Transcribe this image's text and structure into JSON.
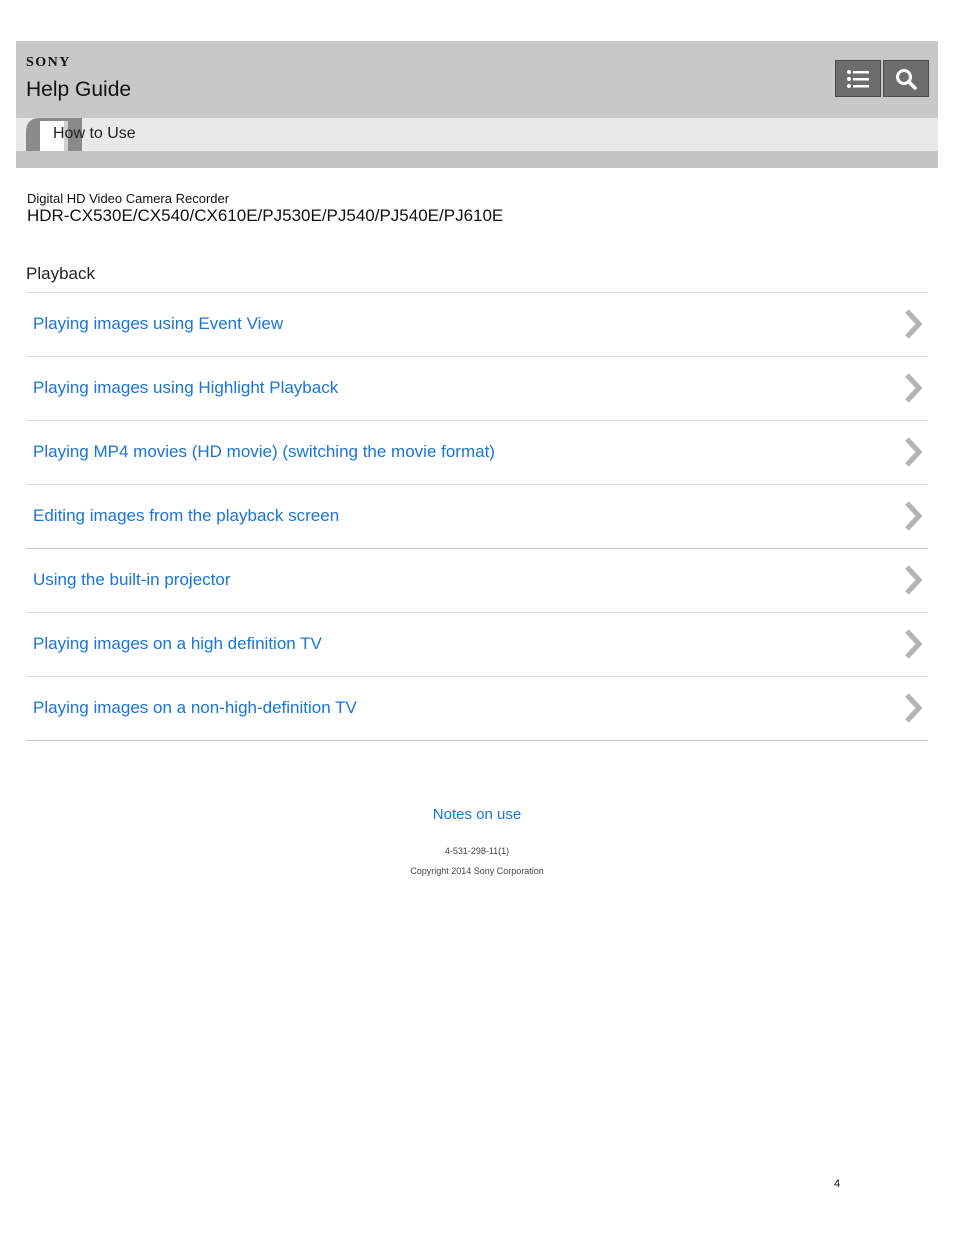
{
  "header": {
    "brand": "SONY",
    "title": "Help Guide",
    "toolbar": {
      "contents_icon": "list-icon",
      "search_icon": "search-icon"
    },
    "breadcrumb": "How to Use"
  },
  "product": {
    "type": "Digital HD Video Camera Recorder",
    "models": "HDR-CX530E/CX540/CX610E/PJ530E/PJ540/PJ540E/PJ610E"
  },
  "section": {
    "title": "Playback",
    "items": [
      {
        "label": "Playing images using Event View"
      },
      {
        "label": "Playing images using Highlight Playback"
      },
      {
        "label": "Playing MP4 movies (HD movie) (switching the movie format)"
      },
      {
        "label": "Editing images from the playback screen"
      },
      {
        "label": "Using the built-in projector"
      },
      {
        "label": "Playing images on a high definition TV"
      },
      {
        "label": "Playing images on a non-high-definition TV"
      }
    ]
  },
  "footer": {
    "notes_link": "Notes on use",
    "doc_code": "4-531-298-11(1)",
    "copyright": "Copyright 2014 Sony Corporation"
  },
  "page_number": "4",
  "colors": {
    "link": "#1a73d9",
    "header_bg": "#c8c8c8",
    "breadcrumb_bg": "#e9e9e9",
    "button_bg": "#6d6d6d"
  }
}
